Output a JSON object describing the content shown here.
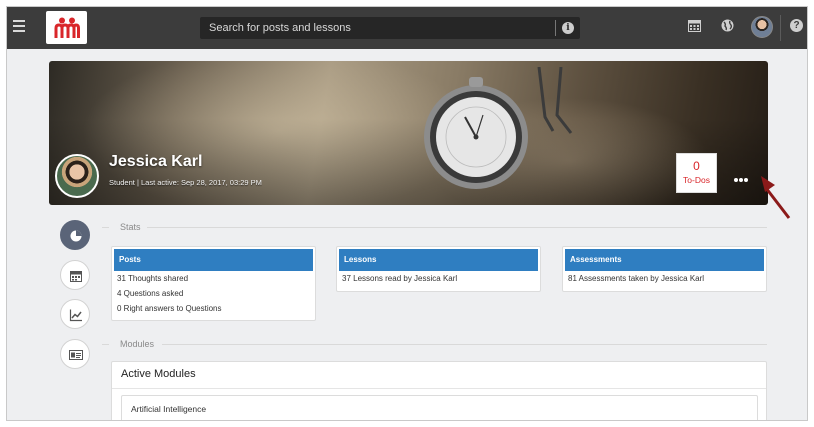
{
  "topbar": {
    "search": {
      "placeholder": "Search for posts and lessons",
      "value": ""
    },
    "icons": [
      "menu-icon",
      "logo",
      "info-icon",
      "calendar-icon",
      "globe-icon",
      "user-avatar",
      "help-icon"
    ],
    "help_glyph": "?",
    "info_glyph": "i"
  },
  "banner": {
    "name": "Jessica Karl",
    "meta": "Student | Last active: Sep 28, 2017, 03:29 PM",
    "todos": {
      "count": "0",
      "label": "To-Dos"
    },
    "more_icon": "ellipsis-icon"
  },
  "sidenav": {
    "items": [
      "stats-pie-icon",
      "calendar-icon",
      "chart-line-icon",
      "id-card-icon"
    ],
    "active": "stats-pie-icon"
  },
  "stats": {
    "title": "Stats",
    "cards": [
      {
        "header": "Posts",
        "lines": [
          "31 Thoughts shared",
          "4 Questions asked",
          "0 Right answers to Questions"
        ]
      },
      {
        "header": "Lessons",
        "lines": [
          "37 Lessons read by Jessica Karl"
        ]
      },
      {
        "header": "Assessments",
        "lines": [
          "81 Assessments taken by Jessica Karl"
        ]
      }
    ]
  },
  "modules": {
    "title": "Modules",
    "panel_title": "Active Modules",
    "items": [
      "Artificial Intelligence"
    ]
  },
  "colors": {
    "topbar": "#3c3c3c",
    "card_header": "#2f7ec1",
    "todo_red": "#d9262a",
    "logo_red": "#d9262a",
    "active_side": "#5a6478",
    "arrow": "#8b1a1a"
  }
}
